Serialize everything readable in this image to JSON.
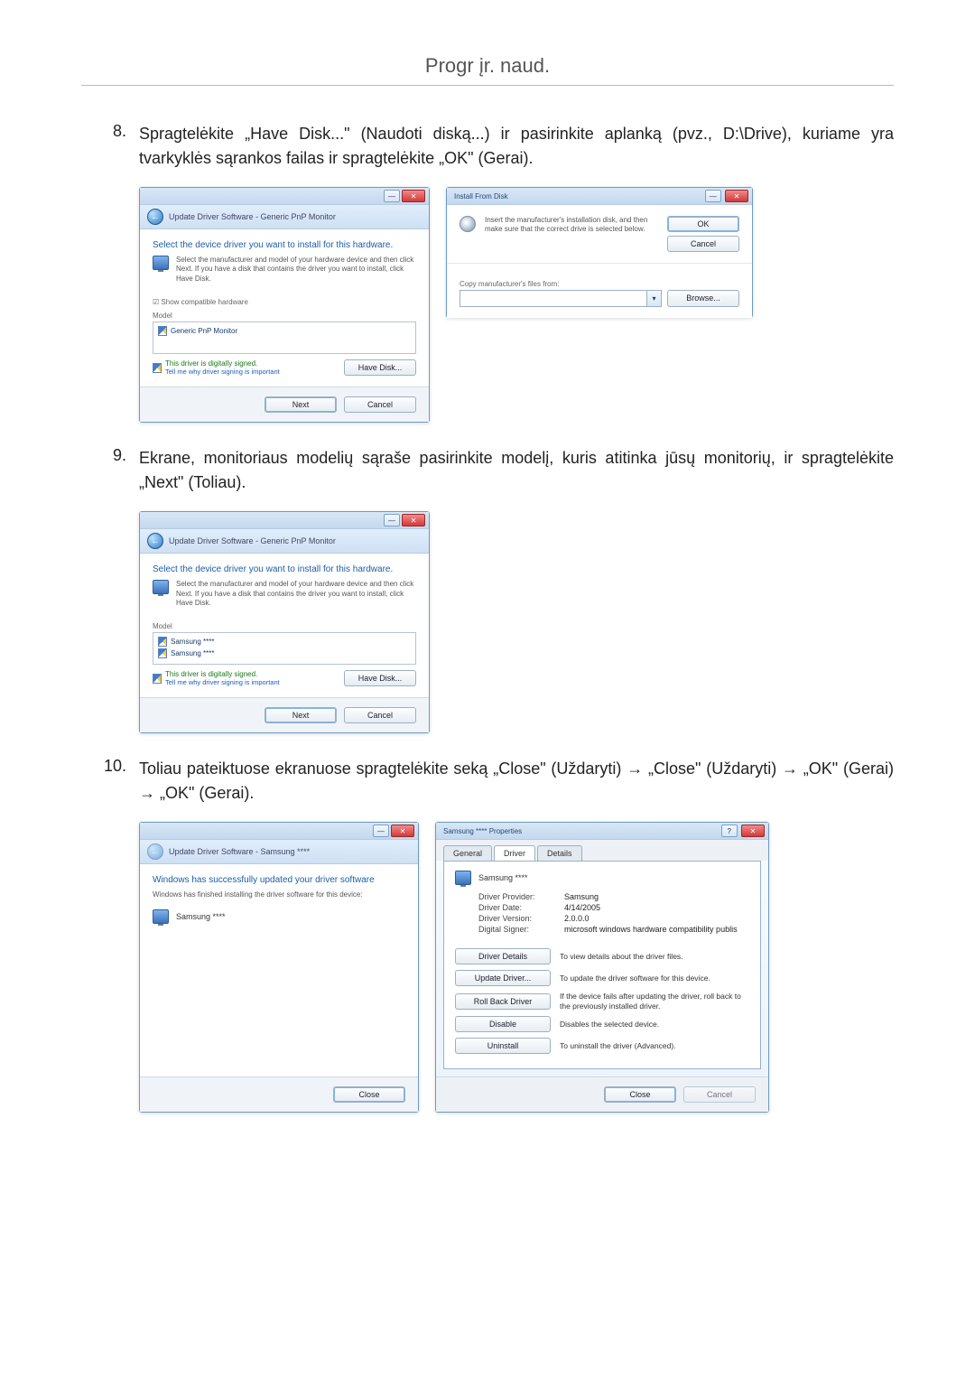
{
  "page_title": "Progr įr. naud.",
  "steps": {
    "8": {
      "num": "8.",
      "text": "Spragtelėkite „Have Disk...\" (Naudoti diską...) ir pasirinkite aplanką (pvz., D:\\Drive), kuriame yra tvarkyklės sąrankos failas ir spragtelėkite „OK\" (Gerai)."
    },
    "9": {
      "num": "9.",
      "text": "Ekrane, monitoriaus modelių sąraše pasirinkite modelį, kuris atitinka jūsų monitorių, ir spragtelėkite „Next\" (Toliau)."
    },
    "10": {
      "num": "10.",
      "text": "Toliau pateiktuose ekranuose spragtelėkite seką „Close\" (Uždaryti) → „Close\" (Uždaryti) → „OK\" (Gerai) → „OK\" (Gerai)."
    }
  },
  "dlg_select_driver": {
    "breadcrumb": "Update Driver Software - Generic PnP Monitor",
    "heading": "Select the device driver you want to install for this hardware.",
    "desc": "Select the manufacturer and model of your hardware device and then click Next. If you have a disk that contains the driver you want to install, click Have Disk.",
    "compat_check": "Show compatible hardware",
    "list_header": "Model",
    "items": {
      "0": "Generic PnP Monitor"
    },
    "signed": "This driver is digitally signed.",
    "signed_link": "Tell me why driver signing is important",
    "have_disk": "Have Disk...",
    "next": "Next",
    "cancel": "Cancel"
  },
  "dlg_install_from_disk": {
    "title": "Install From Disk",
    "msg": "Insert the manufacturer's installation disk, and then make sure that the correct drive is selected below.",
    "ok": "OK",
    "cancel": "Cancel",
    "copy_label": "Copy manufacturer's files from:",
    "combo_value": "",
    "browse": "Browse..."
  },
  "dlg_select_model": {
    "breadcrumb": "Update Driver Software - Generic PnP Monitor",
    "heading": "Select the device driver you want to install for this hardware.",
    "desc": "Select the manufacturer and model of your hardware device and then click Next. If you have a disk that contains the driver you want to install, click Have Disk.",
    "list_header": "Model",
    "items": {
      "0": "Samsung ****",
      "1": "Samsung ****"
    },
    "signed": "This driver is digitally signed.",
    "signed_link": "Tell me why driver signing is important",
    "have_disk": "Have Disk...",
    "next": "Next",
    "cancel": "Cancel"
  },
  "dlg_success": {
    "breadcrumb": "Update Driver Software - Samsung ****",
    "heading": "Windows has successfully updated your driver software",
    "desc": "Windows has finished installing the driver software for this device:",
    "device": "Samsung ****",
    "close": "Close"
  },
  "dlg_props": {
    "title": "Samsung **** Properties",
    "tabs": {
      "0": "General",
      "1": "Driver",
      "2": "Details"
    },
    "device": "Samsung ****",
    "rows": {
      "provider": {
        "lbl": "Driver Provider:",
        "val": "Samsung"
      },
      "date": {
        "lbl": "Driver Date:",
        "val": "4/14/2005"
      },
      "version": {
        "lbl": "Driver Version:",
        "val": "2.0.0.0"
      },
      "signer": {
        "lbl": "Digital Signer:",
        "val": "microsoft windows hardware compatibility publis"
      }
    },
    "actions": {
      "details": {
        "btn": "Driver Details",
        "desc": "To view details about the driver files."
      },
      "update": {
        "btn": "Update Driver...",
        "desc": "To update the driver software for this device."
      },
      "rollback": {
        "btn": "Roll Back Driver",
        "desc": "If the device fails after updating the driver, roll back to the previously installed driver."
      },
      "disable": {
        "btn": "Disable",
        "desc": "Disables the selected device."
      },
      "uninstall": {
        "btn": "Uninstall",
        "desc": "To uninstall the driver (Advanced)."
      }
    },
    "close": "Close",
    "cancel": "Cancel"
  }
}
